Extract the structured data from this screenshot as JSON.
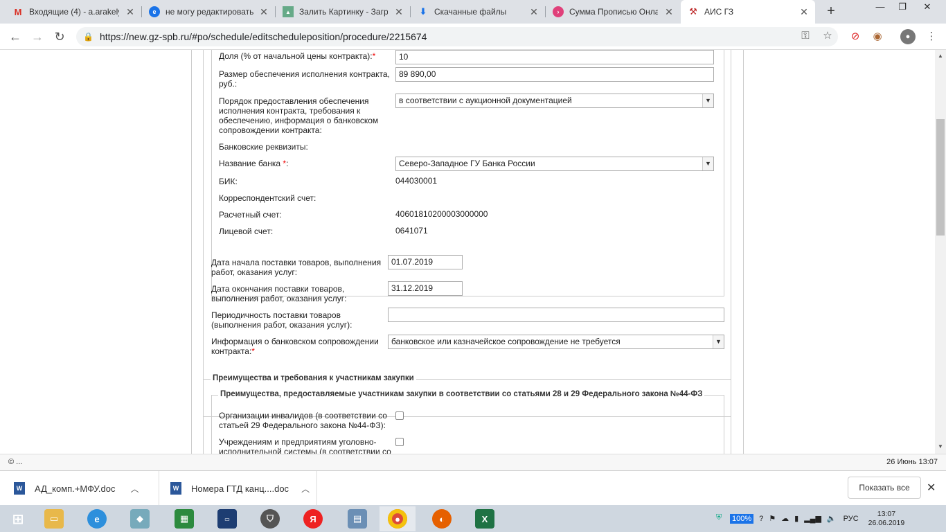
{
  "browser": {
    "tabs": [
      {
        "title": "Входящие (4) - a.arakely",
        "icon": "gmail-icon"
      },
      {
        "title": "не могу редактировать",
        "icon": "chat-icon"
      },
      {
        "title": "Залить Картинку - Загру",
        "icon": "image-upload-icon"
      },
      {
        "title": "Скачанные файлы",
        "icon": "download-icon"
      },
      {
        "title": "Сумма Прописью Онла",
        "icon": "site-icon"
      },
      {
        "title": "АИС ГЗ",
        "icon": "gavel-icon"
      }
    ],
    "active_tab_index": 5,
    "url": "https://new.gz-spb.ru/#po/schedule/editscheduleposition/procedure/2215674"
  },
  "form": {
    "share_label": "Доля (% от начальной цены контракта):",
    "share_value": "10",
    "security_amount_label_1": "Размер обеспечения исполнения контракта,",
    "security_amount_label_2": "руб.:",
    "security_amount_value": "89 890,00",
    "security_order_label_1": "Порядок предоставления обеспечения",
    "security_order_label_2": "исполнения контракта, требования к",
    "security_order_label_3": "обеспечению, информация о банковском",
    "security_order_label_4": "сопровождении контракта:",
    "security_order_value": "в соответствии с аукционной документацией",
    "bank_details_label": "Банковские реквизиты:",
    "bank_name_label": "Название банка",
    "bank_name_value": "Северо-Западное ГУ Банка России",
    "bik_label": "БИК:",
    "bik_value": "044030001",
    "corr_account_label": "Корреспондентский счет:",
    "settlement_account_label": "Расчетный счет:",
    "settlement_account_value": "40601810200003000000",
    "personal_account_label": "Лицевой счет:",
    "personal_account_value": "0641071",
    "delivery_start_label_1": "Дата начала поставки товаров, выполнения",
    "delivery_start_label_2": "работ, оказания услуг:",
    "delivery_start_value": "01.07.2019",
    "delivery_end_label_1": "Дата окончания поставки товаров,",
    "delivery_end_label_2": "выполнения работ, оказания услуг:",
    "delivery_end_value": "31.12.2019",
    "periodicity_label_1": "Периодичность поставки товаров",
    "periodicity_label_2": "(выполнения работ, оказания услуг):",
    "periodicity_value": "",
    "bank_support_label_1": "Информация о банковском сопровождении",
    "bank_support_label_2": "контракта:",
    "bank_support_value": "банковское или казначейское сопровождение не требуется",
    "required_mark": "*"
  },
  "advantages": {
    "section_title": "Преимущества и требования к участникам закупки",
    "subsection_title": "Преимущества, предоставляемые участникам закупки в соответствии со статьями 28 и 29 Федерального закона №44-ФЗ",
    "disabled_orgs_label_1": "Организации инвалидов (в соответствии со",
    "disabled_orgs_label_2": "статьей 29 Федерального закона №44-ФЗ):",
    "penal_orgs_label_1": "Учреждениям и предприятиям уголовно-",
    "penal_orgs_label_2": "исполнительной системы (в соответствии со"
  },
  "statusbar": {
    "left": "© ...",
    "right": "26 Июнь 13:07"
  },
  "downloads": {
    "items": [
      "АД_комп.+МФУ.doc",
      "Номера ГТД канц....doc"
    ],
    "show_all": "Показать все"
  },
  "taskbar": {
    "battery": "100%",
    "lang": "РУС",
    "time": "13:07",
    "date": "26.06.2019"
  }
}
